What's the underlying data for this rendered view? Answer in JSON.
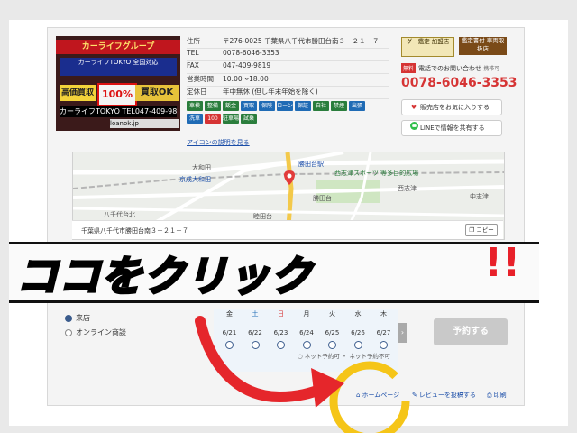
{
  "photo": {
    "sign_top": "カーライフグループ",
    "banner": "カーライフTOKYO 全国対応",
    "badge": "100%",
    "kaitori": "買取OK",
    "yellow": "高価買取",
    "phone": "カーライフTOKYO TEL047-409-9818",
    "url": "loanok.jp"
  },
  "info": [
    {
      "key": "住所",
      "value": "〒276-0025 千葉県八千代市勝田台南３－２１－７"
    },
    {
      "key": "TEL",
      "value": "0078-6046-3353"
    },
    {
      "key": "FAX",
      "value": "047-409-9819"
    },
    {
      "key": "営業時間",
      "value": "10:00～18:00"
    },
    {
      "key": "定休日",
      "value": "年中無休 (但し年末年始を除く)"
    }
  ],
  "icons": [
    "車検",
    "整備",
    "鈑金",
    "買取",
    "保険",
    "ローン",
    "保証",
    "自社",
    "禁煙",
    "出張",
    "洗車",
    "100",
    "駐車場",
    "試乗"
  ],
  "icon_colors": [
    "#2a7d3c",
    "#2a7d3c",
    "#2a7d3c",
    "#1f6bb5",
    "#1f6bb5",
    "#1f6bb5",
    "#1f6bb5",
    "#2a7d3c",
    "#2a7d3c",
    "#1f6bb5",
    "#1f6bb5",
    "#d63434",
    "#2a7d3c",
    "#2a7d3c"
  ],
  "icon_link": "アイコンの説明を見る",
  "cert1": "グー鑑定 加盟店",
  "cert2": "鑑定書付 車両取扱店",
  "inquiry": {
    "free": "無料",
    "label": "電話でのお問い合わせ",
    "note": "携帯可"
  },
  "phone_number": "0078-6046-3353",
  "favorite_btn": "販売店をお気に入りする",
  "line_btn": "LINEで情報を共有する",
  "map": {
    "labels": [
      "大和田",
      "京成大和田",
      "八千代台北",
      "勝田台",
      "西志津スポーツ 等多目的広場",
      "西志津",
      "勝田台駅",
      "中志津",
      "睦田台"
    ],
    "address": "千葉県八千代市勝田台南３－２１－７",
    "copy": "コピー"
  },
  "overlay": {
    "click_text": "ココをクリック",
    "marks": "!!"
  },
  "form": {
    "visit": "来店",
    "online": "オンライン商談",
    "legend": "○ ネット予約可 ・ ネット予約不可"
  },
  "calendar": {
    "dows": [
      "金",
      "土",
      "日",
      "月",
      "火",
      "水",
      "木"
    ],
    "dow_colors": [
      "#333333",
      "#1f6bb5",
      "#d63434",
      "#333333",
      "#333333",
      "#333333",
      "#333333"
    ],
    "dates": [
      "6/21",
      "6/22",
      "6/23",
      "6/24",
      "6/25",
      "6/26",
      "6/27"
    ],
    "next": "›"
  },
  "reserve_btn": "予約する",
  "bottom": {
    "homepage": "ホームページ",
    "review": "レビューを投稿する",
    "print": "印刷"
  }
}
